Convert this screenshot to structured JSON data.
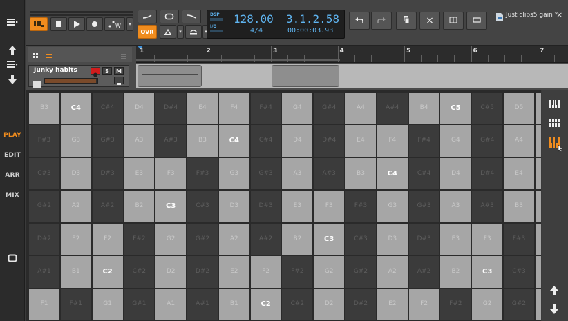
{
  "sidebar": {
    "modes": [
      {
        "label": "PLAY",
        "active": true
      },
      {
        "label": "EDIT",
        "active": false
      },
      {
        "label": "ARR",
        "active": false
      },
      {
        "label": "MIX",
        "active": false
      }
    ],
    "icons": [
      "menu-icon",
      "arrow-up-icon",
      "list-icon",
      "arrow-down-icon",
      "panel-icon"
    ]
  },
  "transport": {
    "ovr_label": "OVR",
    "dsp_label": "DSP",
    "io_label": "I/O",
    "tempo": "128.00",
    "time_signature": "4/4",
    "position_bars": "3.1.2.58",
    "position_time": "00:00:03.93",
    "project_title": "Just clips5 gain *",
    "close_glyph": "×"
  },
  "timeline": {
    "bar_numbers": [
      "1",
      "2",
      "3",
      "4",
      "5",
      "6",
      "7"
    ],
    "track": {
      "name": "Junky habits",
      "solo_label": "S",
      "mute_label": "M"
    }
  },
  "grid": {
    "colors": {
      "white_pad": "#a6a6a6",
      "black_pad": "#3b3b3b",
      "accent": "#f08c1e"
    },
    "rows": [
      [
        "B3",
        "C4",
        "C#4",
        "D4",
        "D#4",
        "E4",
        "F4",
        "F#4",
        "G4",
        "G#4",
        "A4",
        "A#4",
        "B4",
        "C5",
        "C#5",
        "D5"
      ],
      [
        "F#3",
        "G3",
        "G#3",
        "A3",
        "A#3",
        "B3",
        "C4",
        "C#4",
        "D4",
        "D#4",
        "E4",
        "F4",
        "F#4",
        "G4",
        "G#4",
        "A4"
      ],
      [
        "C#3",
        "D3",
        "D#3",
        "E3",
        "F3",
        "F#3",
        "G3",
        "G#3",
        "A3",
        "A#3",
        "B3",
        "C4",
        "C#4",
        "D4",
        "D#4",
        "E4"
      ],
      [
        "G#2",
        "A2",
        "A#2",
        "B2",
        "C3",
        "C#3",
        "D3",
        "D#3",
        "E3",
        "F3",
        "F#3",
        "G3",
        "G#3",
        "A3",
        "A#3",
        "B3"
      ],
      [
        "D#2",
        "E2",
        "F2",
        "F#2",
        "G2",
        "G#2",
        "A2",
        "A#2",
        "B2",
        "C3",
        "C#3",
        "D3",
        "D#3",
        "E3",
        "F3",
        "F#3"
      ],
      [
        "A#1",
        "B1",
        "C2",
        "C#2",
        "D2",
        "D#2",
        "E2",
        "F2",
        "F#2",
        "G2",
        "G#2",
        "A2",
        "A#2",
        "B2",
        "C3",
        "C#3"
      ],
      [
        "F1",
        "F#1",
        "G1",
        "G#1",
        "A1",
        "A#1",
        "B1",
        "C2",
        "C#2",
        "D2",
        "D#2",
        "E2",
        "F2",
        "F#2",
        "G2",
        "G#2"
      ]
    ]
  }
}
